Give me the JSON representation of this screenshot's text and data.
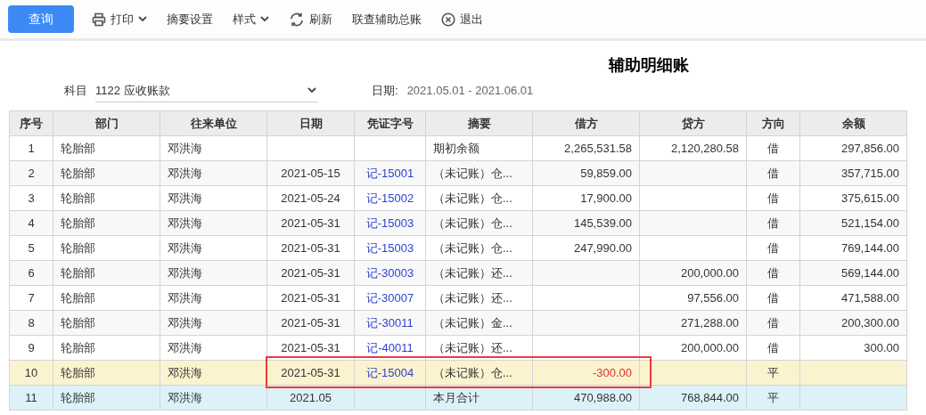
{
  "toolbar": {
    "query_button": "查询",
    "items": [
      {
        "kind": "print",
        "label": "打印"
      },
      {
        "kind": "plain",
        "label": "摘要设置"
      },
      {
        "kind": "dropdown",
        "label": "样式"
      },
      {
        "kind": "refresh",
        "label": "刷新"
      },
      {
        "kind": "plain",
        "label": "联查辅助总账"
      },
      {
        "kind": "exit",
        "label": "退出"
      }
    ]
  },
  "title": "辅助明细账",
  "filters": {
    "subject_label": "科目",
    "subject_value": "1122 应收账款",
    "date_label": "日期:",
    "date_value": "2021.05.01 - 2021.06.01"
  },
  "table": {
    "columns": [
      "序号",
      "部门",
      "往来单位",
      "日期",
      "凭证字号",
      "摘要",
      "借方",
      "贷方",
      "方向",
      "余额"
    ],
    "rows": [
      {
        "kind": "normal",
        "selected": false,
        "cells": [
          "1",
          "轮胎部",
          "邓洪海",
          "",
          "",
          "期初余额",
          "2,265,531.58",
          "2,120,280.58",
          "借",
          "297,856.00"
        ]
      },
      {
        "kind": "normal",
        "selected": false,
        "cells": [
          "2",
          "轮胎部",
          "邓洪海",
          "2021-05-15",
          "记-15001",
          "（未记账）仓...",
          "59,859.00",
          "",
          "借",
          "357,715.00"
        ]
      },
      {
        "kind": "normal",
        "selected": false,
        "cells": [
          "3",
          "轮胎部",
          "邓洪海",
          "2021-05-24",
          "记-15002",
          "（未记账）仓...",
          "17,900.00",
          "",
          "借",
          "375,615.00"
        ]
      },
      {
        "kind": "normal",
        "selected": false,
        "cells": [
          "4",
          "轮胎部",
          "邓洪海",
          "2021-05-31",
          "记-15003",
          "（未记账）仓...",
          "145,539.00",
          "",
          "借",
          "521,154.00"
        ]
      },
      {
        "kind": "normal",
        "selected": false,
        "cells": [
          "5",
          "轮胎部",
          "邓洪海",
          "2021-05-31",
          "记-15003",
          "（未记账）仓...",
          "247,990.00",
          "",
          "借",
          "769,144.00"
        ]
      },
      {
        "kind": "normal",
        "selected": false,
        "cells": [
          "6",
          "轮胎部",
          "邓洪海",
          "2021-05-31",
          "记-30003",
          "（未记账）还...",
          "",
          "200,000.00",
          "借",
          "569,144.00"
        ]
      },
      {
        "kind": "normal",
        "selected": false,
        "cells": [
          "7",
          "轮胎部",
          "邓洪海",
          "2021-05-31",
          "记-30007",
          "（未记账）还...",
          "",
          "97,556.00",
          "借",
          "471,588.00"
        ]
      },
      {
        "kind": "normal",
        "selected": false,
        "cells": [
          "8",
          "轮胎部",
          "邓洪海",
          "2021-05-31",
          "记-30011",
          "（未记账）金...",
          "",
          "271,288.00",
          "借",
          "200,300.00"
        ]
      },
      {
        "kind": "normal",
        "selected": false,
        "cells": [
          "9",
          "轮胎部",
          "邓洪海",
          "2021-05-31",
          "记-40011",
          "（未记账）还...",
          "",
          "200,000.00",
          "借",
          "300.00"
        ]
      },
      {
        "kind": "normal",
        "selected": true,
        "outlined": true,
        "debit_negative": true,
        "cells": [
          "10",
          "轮胎部",
          "邓洪海",
          "2021-05-31",
          "记-15004",
          "（未记账）仓...",
          "-300.00",
          "",
          "平",
          ""
        ]
      },
      {
        "kind": "total",
        "selected": false,
        "cells": [
          "11",
          "轮胎部",
          "邓洪海",
          "2021.05",
          "",
          "本月合计",
          "470,988.00",
          "768,844.00",
          "平",
          ""
        ]
      }
    ]
  }
}
